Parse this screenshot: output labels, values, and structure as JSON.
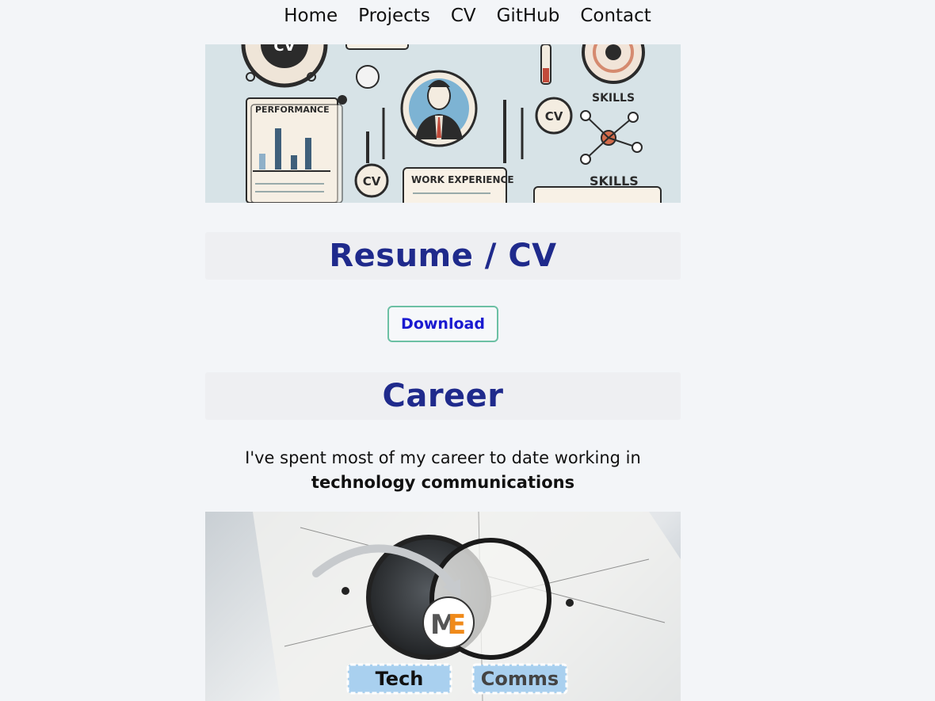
{
  "nav": {
    "items": [
      {
        "label": "Home"
      },
      {
        "label": "Projects"
      },
      {
        "label": "CV"
      },
      {
        "label": "GitHub"
      },
      {
        "label": "Contact"
      }
    ]
  },
  "hero": {
    "labels": {
      "performance": "PERFORMANCE",
      "work_experience": "WORK EXPERIENCE",
      "skills_top": "SKILLS",
      "skills_bottom": "SKILLS",
      "cv1": "CV",
      "cv2": "CV",
      "cv3": "CV"
    }
  },
  "resume": {
    "title": "Resume / CV",
    "download_label": "Download"
  },
  "career": {
    "title": "Career",
    "text_line1": "I've spent most of my career to date working in",
    "text_bold": "technology communications"
  },
  "venn": {
    "logo_m": "M",
    "logo_e": "E",
    "left_label": "Tech",
    "right_label": "Comms"
  },
  "colors": {
    "heading": "#1f2a8c",
    "button_text": "#1a1ad0",
    "button_border": "#6cc0a4",
    "background": "#f3f5f8"
  }
}
